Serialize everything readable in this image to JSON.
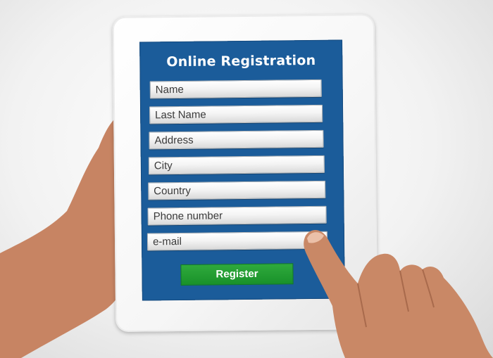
{
  "form": {
    "title": "Online Registration",
    "fields": [
      {
        "label": "Name"
      },
      {
        "label": "Last Name"
      },
      {
        "label": "Address"
      },
      {
        "label": "City"
      },
      {
        "label": "Country"
      },
      {
        "label": "Phone number"
      },
      {
        "label": "e-mail"
      }
    ],
    "submit_label": "Register"
  },
  "colors": {
    "screen": "#1b5c9a",
    "button": "#19912a",
    "skin": "#c98866"
  }
}
